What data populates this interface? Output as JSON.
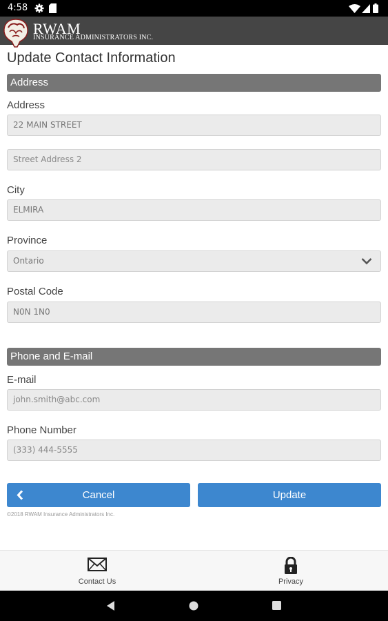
{
  "status_bar": {
    "time": "4:58"
  },
  "header": {
    "brand_name": "RWAM",
    "brand_subtitle": "INSURANCE ADMINISTRATORS INC."
  },
  "page": {
    "title": "Update Contact Information"
  },
  "address_section": {
    "heading": "Address",
    "address_label": "Address",
    "address_value": "22 MAIN STREET",
    "address2_placeholder": "Street Address 2",
    "city_label": "City",
    "city_value": "ELMIRA",
    "province_label": "Province",
    "province_selected": "Ontario",
    "postal_label": "Postal Code",
    "postal_value": "N0N 1N0"
  },
  "contact_section": {
    "heading": "Phone and E-mail",
    "email_label": "E-mail",
    "email_placeholder": "john.smith@abc.com",
    "phone_label": "Phone Number",
    "phone_placeholder": "(333) 444-5555"
  },
  "actions": {
    "cancel_label": "Cancel",
    "update_label": "Update"
  },
  "footer": {
    "copyright": "©2018 RWAM Insurance Administrators Inc."
  },
  "bottom_nav": {
    "items": [
      {
        "label": "Contact Us",
        "icon": "envelope-icon"
      },
      {
        "label": "Privacy",
        "icon": "lock-icon"
      }
    ]
  },
  "colors": {
    "header_bg": "#454545",
    "section_bar": "#767676",
    "button": "#3d87cf"
  }
}
